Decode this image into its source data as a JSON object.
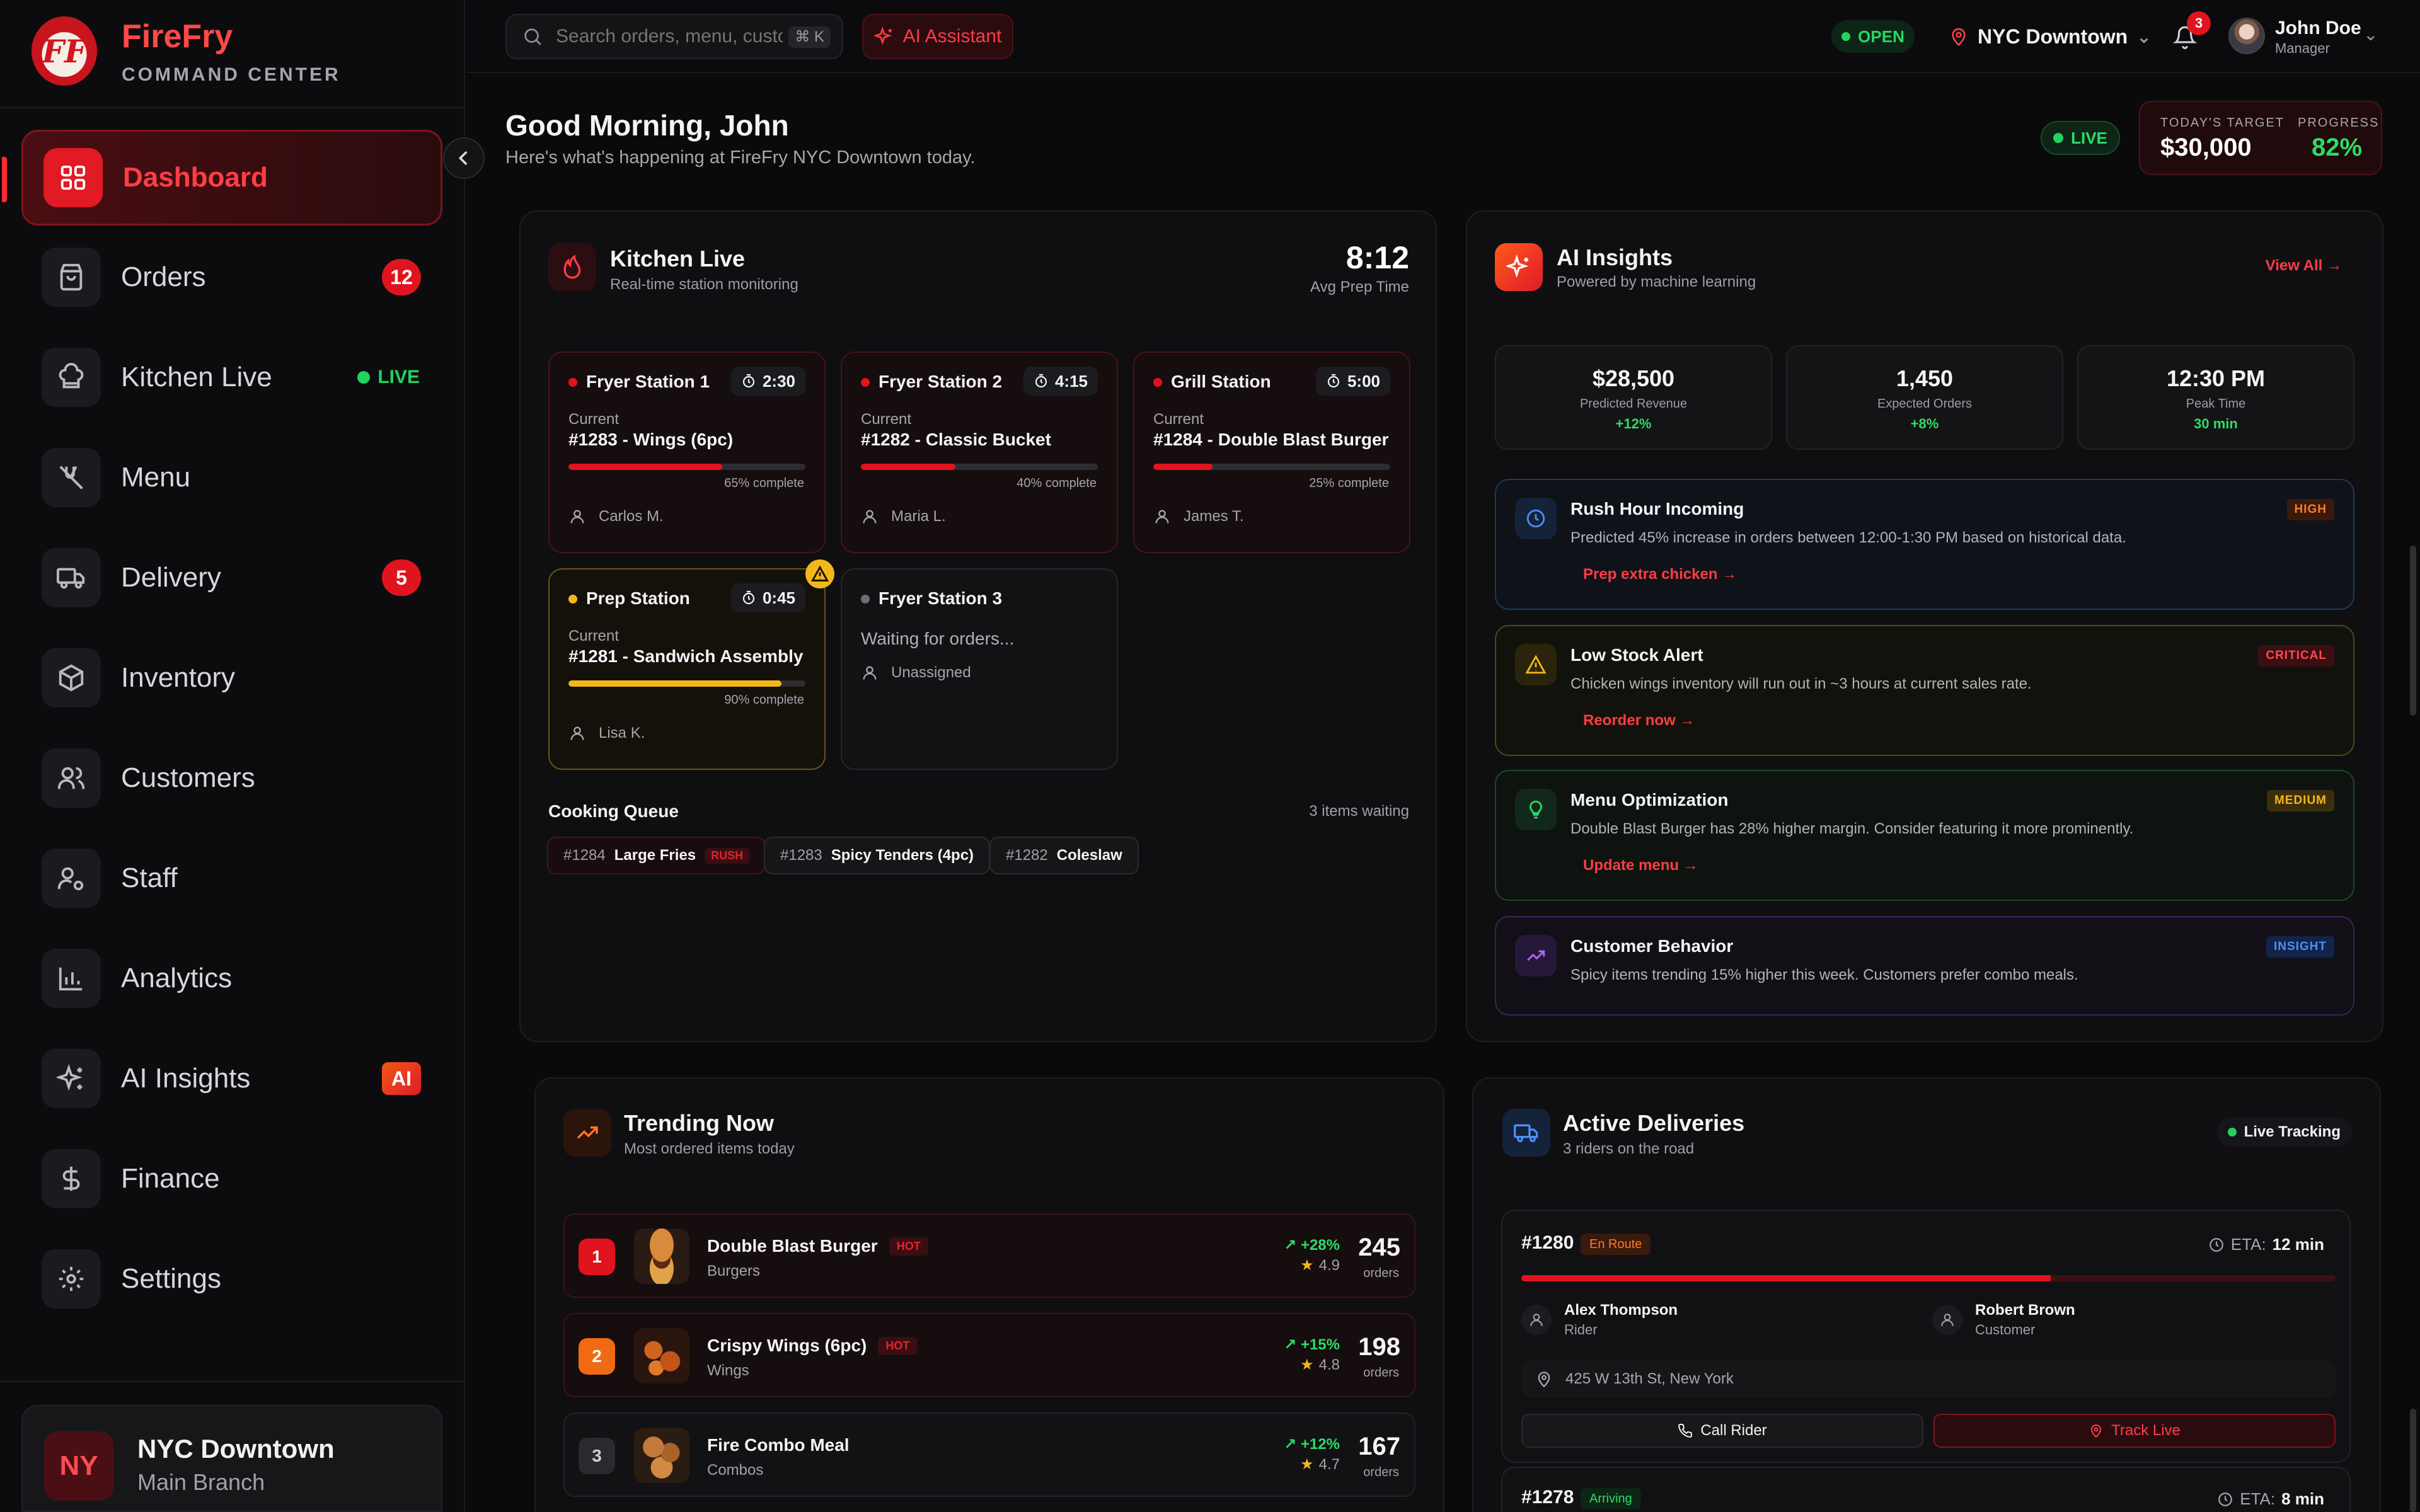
{
  "brand": {
    "logo_text": "FF",
    "name": "FireFry",
    "subtitle": "COMMAND CENTER"
  },
  "sidebar": {
    "items": [
      {
        "label": "Dashboard",
        "icon": "dashboard-icon",
        "active": true
      },
      {
        "label": "Orders",
        "icon": "shopping-bag-icon",
        "badge": "12"
      },
      {
        "label": "Kitchen Live",
        "icon": "chef-hat-icon",
        "live": "LIVE"
      },
      {
        "label": "Menu",
        "icon": "utensils-icon"
      },
      {
        "label": "Delivery",
        "icon": "truck-icon",
        "badge": "5"
      },
      {
        "label": "Inventory",
        "icon": "package-icon"
      },
      {
        "label": "Customers",
        "icon": "users-icon"
      },
      {
        "label": "Staff",
        "icon": "user-cog-icon"
      },
      {
        "label": "Analytics",
        "icon": "bar-chart-icon"
      },
      {
        "label": "AI Insights",
        "icon": "sparkles-icon",
        "badge": "AI"
      },
      {
        "label": "Finance",
        "icon": "dollar-icon"
      },
      {
        "label": "Settings",
        "icon": "gear-icon"
      }
    ],
    "branch": {
      "avatar": "NY",
      "name": "NYC Downtown",
      "sub": "Main Branch"
    }
  },
  "topbar": {
    "search_placeholder": "Search orders, menu, customers...",
    "shortcut": "⌘ K",
    "ai_button": "AI Assistant",
    "status": "OPEN",
    "location": "NYC Downtown",
    "notifications": "3",
    "user_name": "John Doe",
    "user_role": "Manager"
  },
  "greeting": {
    "title": "Good Morning, John",
    "subtitle": "Here's what's happening at FireFry NYC Downtown today.",
    "live": "LIVE",
    "target_label": "TODAY'S TARGET",
    "target_value": "$30,000",
    "progress_label": "PROGRESS",
    "progress_value": "82%"
  },
  "kitchen": {
    "title": "Kitchen Live",
    "subtitle": "Real-time station monitoring",
    "avg_time": "8:12",
    "avg_label": "Avg Prep Time",
    "stations": [
      {
        "name": "Fryer Station 1",
        "timer": "2:30",
        "current_label": "Current",
        "order": "#1283 - Wings (6pc)",
        "progress": 65,
        "progress_text": "65% complete",
        "person": "Carlos M."
      },
      {
        "name": "Fryer Station 2",
        "timer": "4:15",
        "current_label": "Current",
        "order": "#1282 - Classic Bucket",
        "progress": 40,
        "progress_text": "40% complete",
        "person": "Maria L."
      },
      {
        "name": "Grill Station",
        "timer": "5:00",
        "current_label": "Current",
        "order": "#1284 - Double Blast Burger",
        "progress": 25,
        "progress_text": "25% complete",
        "person": "James T."
      },
      {
        "name": "Prep Station",
        "timer": "0:45",
        "current_label": "Current",
        "order": "#1281 - Sandwich Assembly",
        "progress": 90,
        "progress_text": "90% complete",
        "person": "Lisa K."
      },
      {
        "name": "Fryer Station 3",
        "waiting": "Waiting for orders...",
        "person": "Unassigned"
      }
    ],
    "queue_title": "Cooking Queue",
    "queue_count": "3 items waiting",
    "queue": [
      {
        "num": "#1284",
        "item": "Large Fries",
        "tag": "RUSH"
      },
      {
        "num": "#1283",
        "item": "Spicy Tenders (4pc)"
      },
      {
        "num": "#1282",
        "item": "Coleslaw"
      }
    ]
  },
  "ai": {
    "title": "AI Insights",
    "subtitle": "Powered by machine learning",
    "view_all": "View All →",
    "metrics": [
      {
        "value": "$28,500",
        "label": "Predicted Revenue",
        "sub": "+12%"
      },
      {
        "value": "1,450",
        "label": "Expected Orders",
        "sub": "+8%"
      },
      {
        "value": "12:30 PM",
        "label": "Peak Time",
        "sub": "30 min"
      }
    ],
    "insights": [
      {
        "title": "Rush Hour Incoming",
        "desc": "Predicted 45% increase in orders between 12:00-1:30 PM based on historical data.",
        "action": "Prep extra chicken →",
        "tag": "HIGH"
      },
      {
        "title": "Low Stock Alert",
        "desc": "Chicken wings inventory will run out in ~3 hours at current sales rate.",
        "action": "Reorder now →",
        "tag": "CRITICAL"
      },
      {
        "title": "Menu Optimization",
        "desc": "Double Blast Burger has 28% higher margin. Consider featuring it more prominently.",
        "action": "Update menu →",
        "tag": "MEDIUM"
      },
      {
        "title": "Customer Behavior",
        "desc": "Spicy items trending 15% higher this week. Customers prefer combo meals.",
        "tag": "INSIGHT"
      }
    ]
  },
  "trending": {
    "title": "Trending Now",
    "subtitle": "Most ordered items today",
    "items": [
      {
        "rank": "1",
        "name": "Double Blast Burger",
        "tag": "HOT",
        "category": "Burgers",
        "growth": "+28%",
        "rating": "4.9",
        "count": "245",
        "count_label": "orders"
      },
      {
        "rank": "2",
        "name": "Crispy Wings (6pc)",
        "tag": "HOT",
        "category": "Wings",
        "growth": "+15%",
        "rating": "4.8",
        "count": "198",
        "count_label": "orders"
      },
      {
        "rank": "3",
        "name": "Fire Combo Meal",
        "category": "Combos",
        "growth": "+12%",
        "rating": "4.7",
        "count": "167",
        "count_label": "orders"
      }
    ]
  },
  "deliveries": {
    "title": "Active Deliveries",
    "subtitle": "3 riders on the road",
    "tracking": "Live Tracking",
    "items": [
      {
        "id": "#1280",
        "status": "En Route",
        "eta_label": "ETA:",
        "eta": "12 min",
        "progress": 65,
        "rider": "Alex Thompson",
        "rider_role": "Rider",
        "customer": "Robert Brown",
        "customer_role": "Customer",
        "address": "425 W 13th St, New York",
        "call": "Call Rider",
        "track": "Track Live"
      },
      {
        "id": "#1278",
        "status": "Arriving",
        "eta_label": "ETA:",
        "eta": "8 min"
      }
    ]
  },
  "colors": {
    "accent": "#e0141e",
    "success": "#2bdc66",
    "warning": "#f2b81a",
    "bg": "#0a0a0b"
  }
}
